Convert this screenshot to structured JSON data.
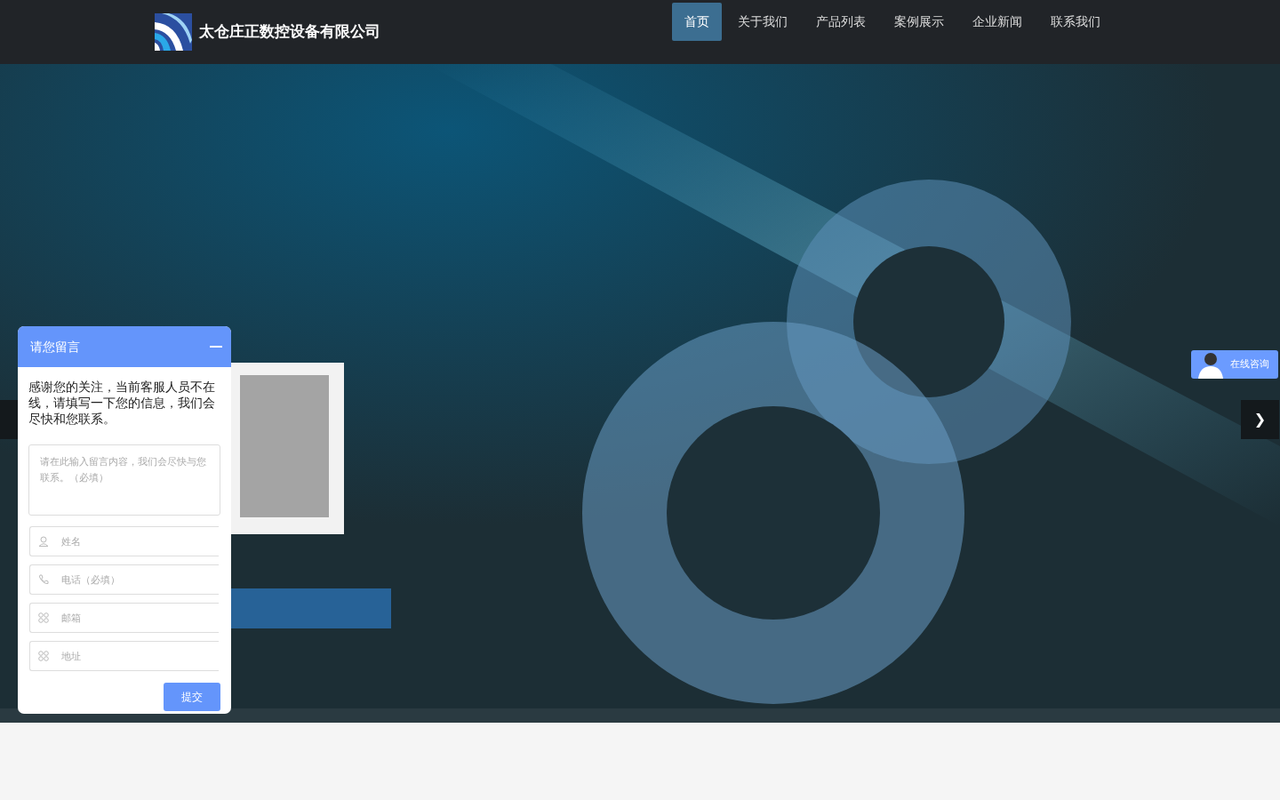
{
  "brand": {
    "name": "太仓庄正数控设备有限公司"
  },
  "nav": [
    {
      "label": "首页",
      "selected": true
    },
    {
      "label": "关于我们",
      "selected": false
    },
    {
      "label": "产品列表",
      "selected": false
    },
    {
      "label": "案例展示",
      "selected": false
    },
    {
      "label": "企业新闻",
      "selected": false
    },
    {
      "label": "联系我们",
      "selected": false
    }
  ],
  "banner": {
    "kind": "picture",
    "next_arrow": "❯"
  },
  "consult_button": {
    "label": "在线咨询"
  },
  "message_widget": {
    "title": "请您留言",
    "intro": "感谢您的关注，当前客服人员不在线，请填写一下您的信息，我们会尽快和您联系。",
    "message_placeholder": "请在此输入留言内容，我们会尽快与您联系。（必填）",
    "fields": [
      {
        "kind": "person",
        "placeholder": "姓名"
      },
      {
        "kind": "phone",
        "placeholder": "电话（必填）"
      },
      {
        "kind": "grid",
        "placeholder": "邮箱"
      },
      {
        "kind": "grid",
        "placeholder": "地址"
      }
    ],
    "submit": "提交"
  }
}
